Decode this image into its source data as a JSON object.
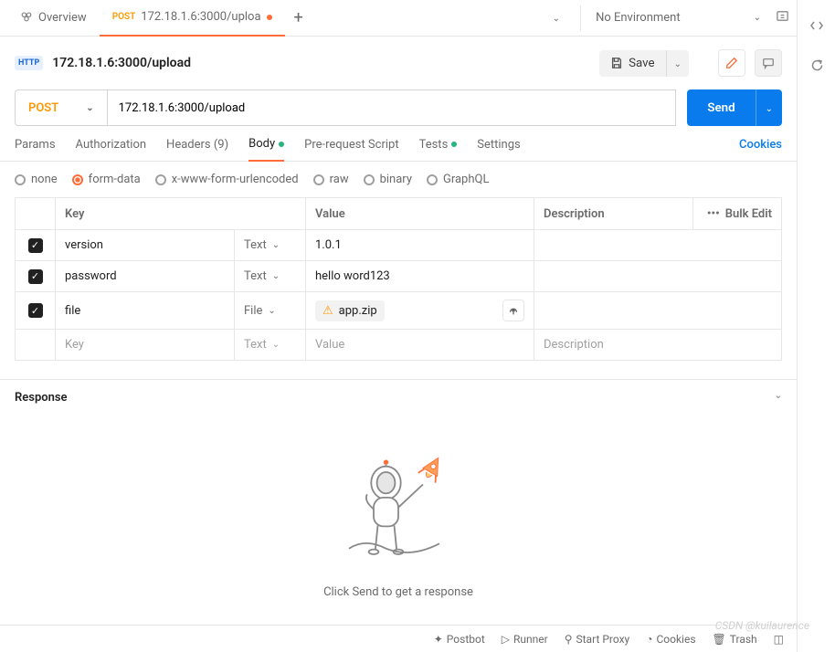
{
  "tabs": {
    "overview": "Overview",
    "active_method": "POST",
    "active_label": "172.18.1.6:3000/uploa"
  },
  "env": {
    "label": "No Environment"
  },
  "request": {
    "title": "172.18.1.6:3000/upload",
    "save_label": "Save",
    "method": "POST",
    "url": "172.18.1.6:3000/upload",
    "send_label": "Send"
  },
  "req_tabs": {
    "params": "Params",
    "auth": "Authorization",
    "headers": "Headers (9)",
    "body": "Body",
    "prerequest": "Pre-request Script",
    "tests": "Tests",
    "settings": "Settings",
    "cookies": "Cookies"
  },
  "body_types": {
    "none": "none",
    "formdata": "form-data",
    "xwww": "x-www-form-urlencoded",
    "raw": "raw",
    "binary": "binary",
    "graphql": "GraphQL"
  },
  "kv": {
    "head_key": "Key",
    "head_value": "Value",
    "head_desc": "Description",
    "bulk": "Bulk Edit",
    "placeholder_key": "Key",
    "placeholder_value": "Value",
    "placeholder_desc": "Description",
    "type_text": "Text",
    "type_file": "File",
    "rows": [
      {
        "key": "version",
        "type": "Text",
        "value": "1.0.1"
      },
      {
        "key": "password",
        "type": "Text",
        "value": "hello word123"
      },
      {
        "key": "file",
        "type": "File",
        "value": "app.zip"
      }
    ]
  },
  "response": {
    "title": "Response",
    "hint": "Click Send to get a response"
  },
  "footer": {
    "postbot": "Postbot",
    "runner": "Runner",
    "proxy": "Start Proxy",
    "cookies": "Cookies",
    "trash": "Trash"
  },
  "watermark": "CSDN @kuilaurence"
}
